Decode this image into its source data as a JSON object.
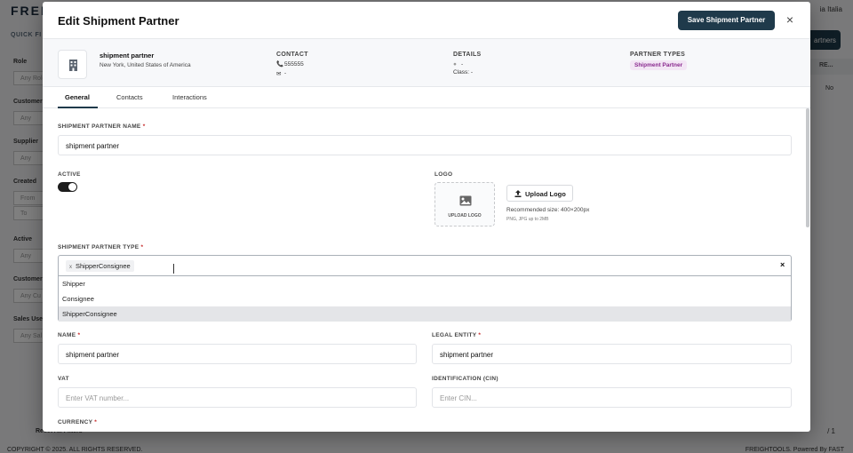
{
  "background": {
    "logo": "FREI",
    "quick_filters": "QUICK FI",
    "filters": [
      {
        "label": "Role",
        "value": "Any Role"
      },
      {
        "label": "Customer",
        "value": "Any"
      },
      {
        "label": "Supplier",
        "value": "Any"
      },
      {
        "label": "Created",
        "value": "From"
      },
      {
        "label": "",
        "value": "To"
      },
      {
        "label": "Active",
        "value": "Any"
      },
      {
        "label": "Customer",
        "value": "Any Cu"
      },
      {
        "label": "Sales User",
        "value": "Any Sal"
      }
    ],
    "user_menu": "ia Italia",
    "add_button": "artners",
    "table_header": "RE...",
    "table_cell": "No",
    "reset_filters": "Reset All Filters",
    "pagination": "/ 1",
    "copyright": "COPYRIGHT © 2025. ALL RIGHTS RESERVED.",
    "powered": "FREIGHTOOLS. Powered By FAST"
  },
  "modal": {
    "title": "Edit Shipment Partner",
    "save_label": "Save Shipment Partner",
    "close_icon": "×",
    "summary": {
      "name": "shipment partner",
      "location": "New York, United States of America",
      "contact_label": "CONTACT",
      "phone": "555555",
      "email": "-",
      "details_label": "DETAILS",
      "details_web": "-",
      "details_class": "Class: -",
      "types_label": "PARTNER TYPES",
      "type_chip": "Shipment Partner"
    },
    "tabs": [
      {
        "label": "General"
      },
      {
        "label": "Contacts"
      },
      {
        "label": "Interactions"
      }
    ],
    "form": {
      "name_label": "SHIPMENT PARTNER NAME",
      "name_value": "shipment partner",
      "active_label": "ACTIVE",
      "active_on": true,
      "logo_label": "LOGO",
      "logo_drop_label": "UPLOAD LOGO",
      "upload_label": "Upload Logo",
      "logo_hint": "Recommended size: 400×200px",
      "logo_hint2": "PNG, JPG up to 2MB",
      "type_label": "SHIPMENT PARTNER TYPE",
      "selected_chip": "ShipperConsignee",
      "chip_remove": "x",
      "clear_icon": "×",
      "options": [
        "Shipper",
        "Consignee",
        "ShipperConsignee"
      ],
      "contact_name_label": "NAME",
      "contact_name_value": "shipment partner",
      "legal_label": "LEGAL ENTITY",
      "legal_value": "shipment partner",
      "vat_label": "VAT",
      "vat_placeholder": "Enter VAT number...",
      "cin_label": "IDENTIFICATION (CIN)",
      "cin_placeholder": "Enter CIN...",
      "currency_label": "CURRENCY",
      "required_mark": "*"
    }
  }
}
